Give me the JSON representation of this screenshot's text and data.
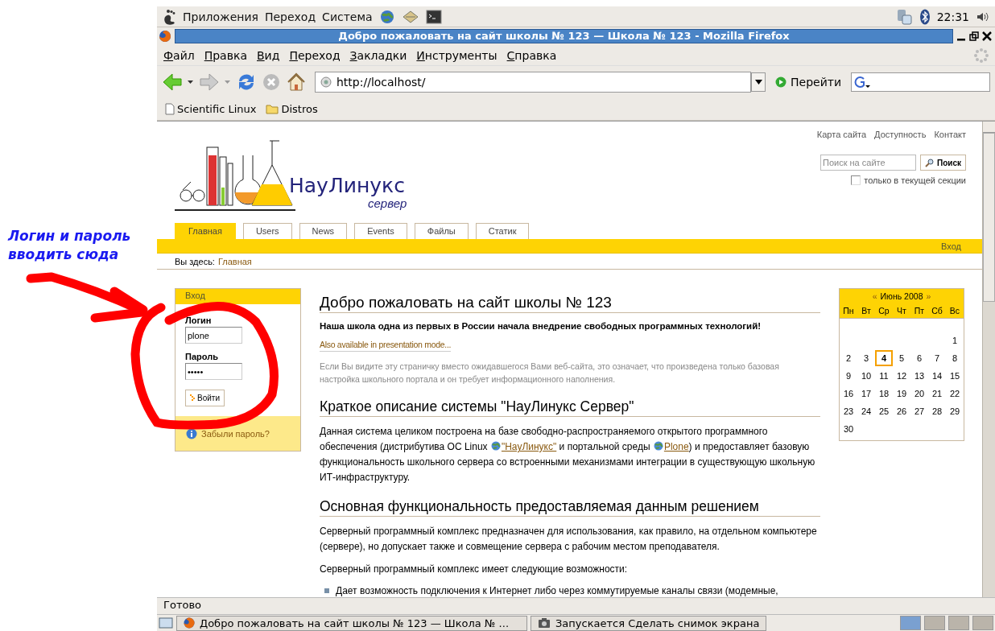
{
  "annotation": {
    "lines": [
      "Логин и пароль",
      "вводить сюда"
    ]
  },
  "top_panel": {
    "menus": [
      "Приложения",
      "Переход",
      "Система"
    ],
    "clock": "22:31"
  },
  "window": {
    "title": "Добро пожаловать на сайт школы № 123 — Школа № 123 - Mozilla Firefox"
  },
  "menu": [
    {
      "label": "Файл"
    },
    {
      "label": "Правка"
    },
    {
      "label": "Вид"
    },
    {
      "label": "Переход"
    },
    {
      "label": "Закладки"
    },
    {
      "label": "Инструменты"
    },
    {
      "label": "Справка"
    }
  ],
  "toolbar": {
    "url": "http://localhost/",
    "go": "Перейти"
  },
  "bookmarks": [
    {
      "label": "Scientific Linux",
      "kind": "page"
    },
    {
      "label": "Distros",
      "kind": "folder"
    }
  ],
  "page": {
    "top_links": [
      "Карта сайта",
      "Доступность",
      "Контакт"
    ],
    "search": {
      "placeholder": "Поиск на сайте",
      "button": "Поиск"
    },
    "section_only": {
      "label": "только в текущей секции",
      "checked": false
    },
    "logo": {
      "name": "НауЛинукс",
      "sub": "сервер"
    },
    "tabs": [
      {
        "label": "Главная",
        "selected": true
      },
      {
        "label": "Users",
        "selected": false
      },
      {
        "label": "News",
        "selected": false
      },
      {
        "label": "Events",
        "selected": false
      },
      {
        "label": "Файлы",
        "selected": false
      },
      {
        "label": "Статик",
        "selected": false
      }
    ],
    "login_link": "Вход",
    "breadcrumb": {
      "label": "Вы здесь:",
      "link": "Главная"
    },
    "login_portlet": {
      "title": "Вход",
      "login_label": "Логин",
      "login_value": "plone",
      "password_label": "Пароль",
      "password_value": "•••••",
      "button": "Войти",
      "forgot": "Забыли пароль?"
    },
    "content": [
      {
        "kind": "h1",
        "text": "Добро пожаловать на сайт школы № 123"
      },
      {
        "kind": "lead",
        "text": "Наша школа одна из первых в России начала внедрение свободных программных технологий!"
      },
      {
        "kind": "link",
        "text": "Also available in presentation mode..."
      },
      {
        "kind": "note",
        "text": "Если Вы видите эту страничку вместо ожидавшегося Вами веб-сайта, это означает, что произведена только базовая настройка школьного портала и он требует информационного наполнения."
      },
      {
        "kind": "h2",
        "text": "Краткое описание системы \"НауЛинукс Сервер\""
      },
      {
        "kind": "para",
        "parts": [
          {
            "text": "Данная система целиком построена на базе свободно-распространяемого открытого программного обеспечения (дистрибутива ОС Linux "
          },
          {
            "link": "\"НауЛинукс\""
          },
          {
            "text": " и портальной среды "
          },
          {
            "link": "Plone"
          },
          {
            "text": ") и предоставляет базовую функциональность школьного сервера со встроенными механизмами интеграции в существующую школьную ИТ-инфраструктуру."
          }
        ]
      },
      {
        "kind": "h2",
        "text": "Основная функциональность предоставляемая данным решением"
      },
      {
        "kind": "para",
        "parts": [
          {
            "text": " Серверный программный комплекс предназначен для использования, как правило, на отдельном компьютере (сервере), но допускает также и совмещение сервера с рабочим местом преподавателя."
          }
        ]
      },
      {
        "kind": "para",
        "parts": [
          {
            "text": "Серверный программный комплекс имеет следующие возможности:"
          }
        ]
      },
      {
        "kind": "bullet",
        "text": "Дает возможность подключения к Интернет либо через коммутируемые каналы связи (модемные,"
      }
    ],
    "calendar": {
      "prev": "«",
      "month": "Июнь 2008",
      "next": "»",
      "weekdays": [
        "Пн",
        "Вт",
        "Ср",
        "Чт",
        "Пт",
        "Сб",
        "Вс"
      ],
      "weeks": [
        {
          "kind": "partial",
          "days": [
            {
              "label": "1",
              "today": false
            }
          ]
        },
        {
          "kind": "full",
          "days": [
            {
              "label": "2",
              "today": false
            },
            {
              "label": "3",
              "today": false
            },
            {
              "label": "4",
              "today": true
            },
            {
              "label": "5",
              "today": false
            },
            {
              "label": "6",
              "today": false
            },
            {
              "label": "7",
              "today": false
            },
            {
              "label": "8",
              "today": false
            }
          ]
        },
        {
          "kind": "full",
          "days": [
            {
              "label": "9",
              "today": false
            },
            {
              "label": "10",
              "today": false
            },
            {
              "label": "11",
              "today": false
            },
            {
              "label": "12",
              "today": false
            },
            {
              "label": "13",
              "today": false
            },
            {
              "label": "14",
              "today": false
            },
            {
              "label": "15",
              "today": false
            }
          ]
        },
        {
          "kind": "full",
          "days": [
            {
              "label": "16",
              "today": false
            },
            {
              "label": "17",
              "today": false
            },
            {
              "label": "18",
              "today": false
            },
            {
              "label": "19",
              "today": false
            },
            {
              "label": "20",
              "today": false
            },
            {
              "label": "21",
              "today": false
            },
            {
              "label": "22",
              "today": false
            }
          ]
        },
        {
          "kind": "full",
          "days": [
            {
              "label": "23",
              "today": false
            },
            {
              "label": "24",
              "today": false
            },
            {
              "label": "25",
              "today": false
            },
            {
              "label": "26",
              "today": false
            },
            {
              "label": "27",
              "today": false
            },
            {
              "label": "28",
              "today": false
            },
            {
              "label": "29",
              "today": false
            }
          ]
        },
        {
          "kind": "last",
          "days": [
            {
              "label": "30",
              "today": false
            }
          ]
        }
      ]
    }
  },
  "status_bar": "Готово",
  "taskbar": [
    {
      "label": "Добро пожаловать на сайт школы № 123 — Школа № ...",
      "kind": "browser"
    },
    {
      "label": "Запускается Сделать снимок экрана",
      "kind": "camera"
    }
  ]
}
